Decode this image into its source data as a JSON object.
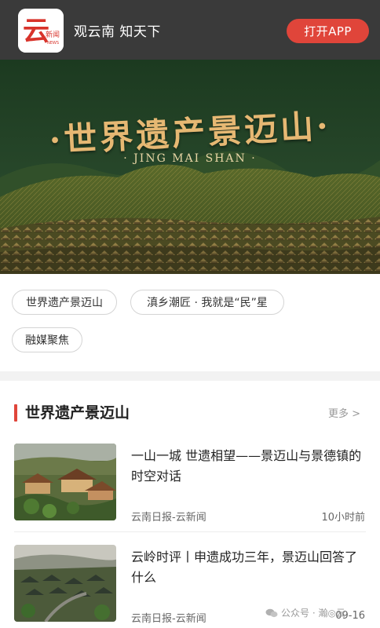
{
  "header": {
    "logo_text": "云",
    "logo_sub": "新闻",
    "logo_en": "NEWS",
    "slogan": "观云南 知天下",
    "open_app_label": "打开APP"
  },
  "banner": {
    "title": "·世界遗产景迈山·",
    "subtitle": "· JING MAI SHAN ·"
  },
  "topics": [
    {
      "label": "世界遗产景迈山"
    },
    {
      "label": "滇乡潮匠 · 我就是“民”星"
    },
    {
      "label": "融媒聚焦"
    }
  ],
  "section": {
    "title": "世界遗产景迈山",
    "more_label": "更多 >"
  },
  "news": [
    {
      "title": "一山一城 世遗相望——景迈山与景德镇的时空对话",
      "source": "云南日报-云新闻",
      "time": "10小时前"
    },
    {
      "title": "云岭时评丨申遗成功三年，景迈山回答了什么",
      "source": "云南日报-云新闻",
      "time": "09-16"
    }
  ],
  "watermark": {
    "text": "公众号 · 瀚◎云"
  },
  "colors": {
    "accent": "#e0453a",
    "topbar": "#3a3a3a",
    "banner_green": "#1f3b22",
    "banner_gold": "#e6b873"
  }
}
